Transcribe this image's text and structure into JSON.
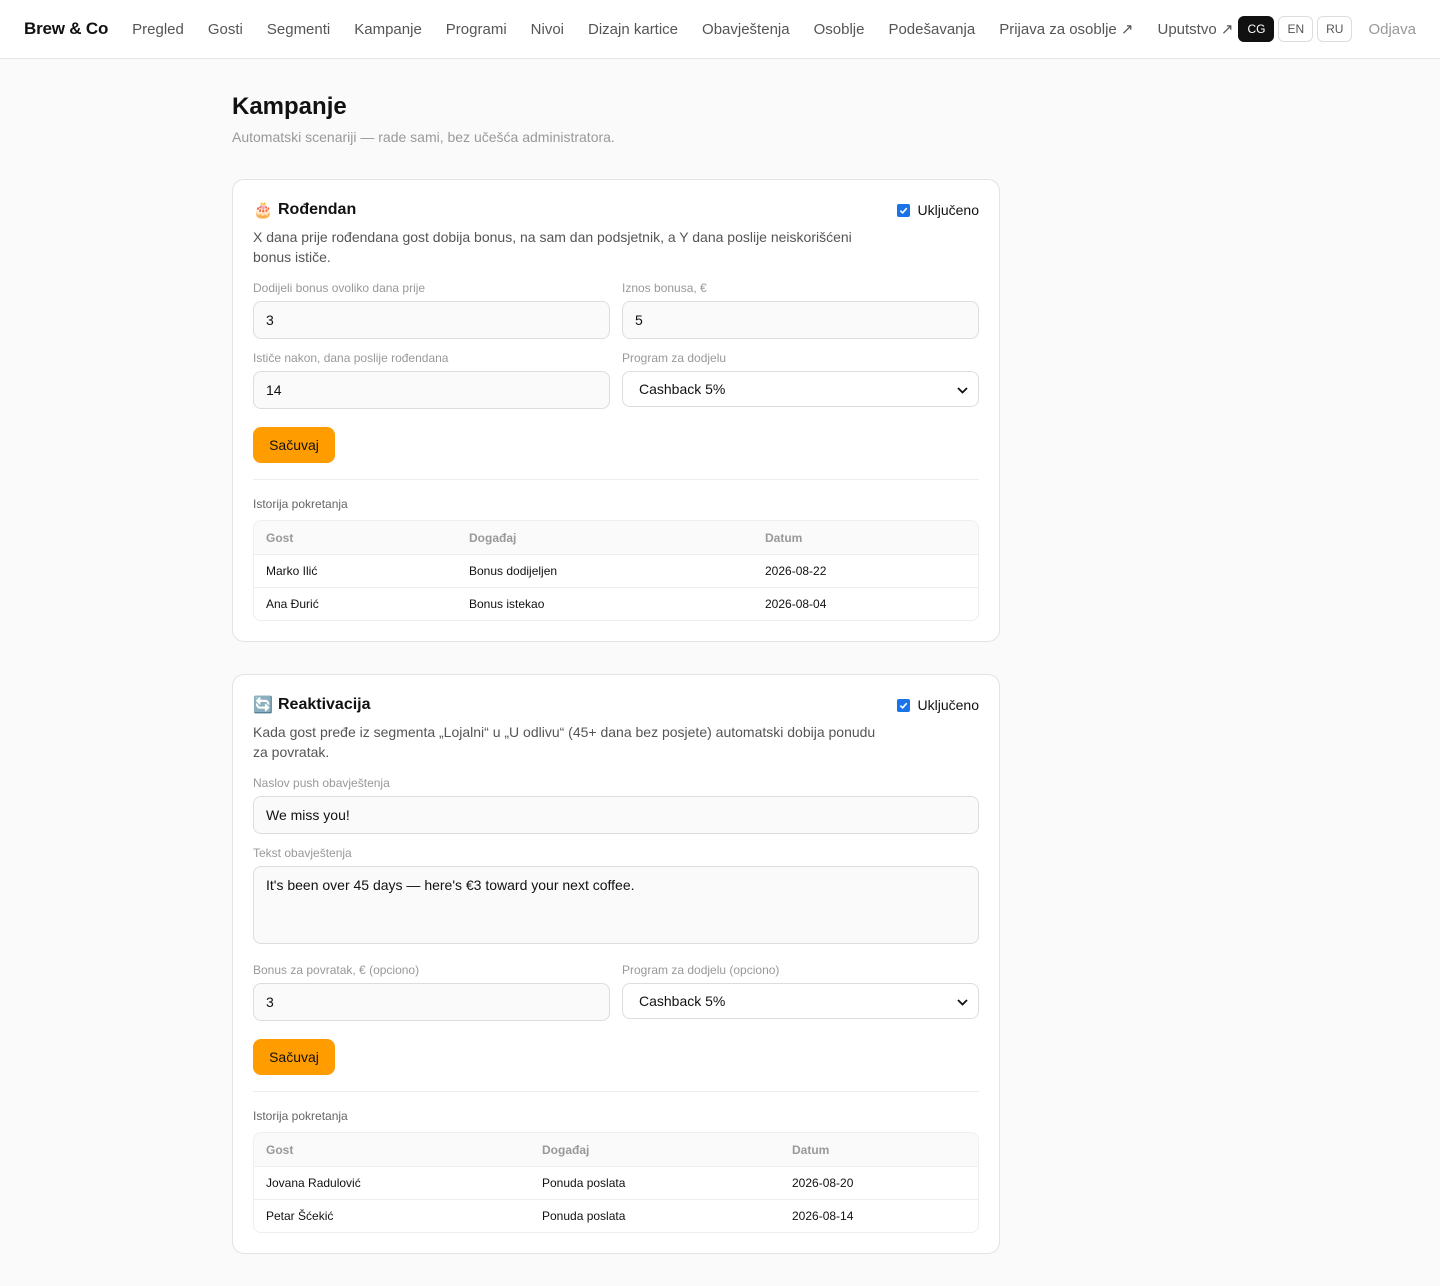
{
  "header": {
    "brand": "Brew & Co",
    "nav": [
      "Pregled",
      "Gosti",
      "Segmenti",
      "Kampanje",
      "Programi",
      "Nivoi",
      "Dizajn kartice",
      "Obavještenja",
      "Osoblje",
      "Podešavanja",
      "Prijava za osoblje ↗",
      "Uputstvo ↗"
    ],
    "languages": [
      "CG",
      "EN",
      "RU"
    ],
    "active_language": "CG",
    "logout": "Odjava"
  },
  "page": {
    "title": "Kampanje",
    "subtitle": "Automatski scenariji — rade sami, bez učešća administratora."
  },
  "colors": {
    "accent": "#ff9d00",
    "checkbox": "#1a73e8",
    "active_lang_bg": "#111111"
  },
  "birthday": {
    "icon": "birthday-cake-icon",
    "icon_glyph": "🎂",
    "title": "Rođendan",
    "enabled_label": "Uključeno",
    "enabled": true,
    "description": "X dana prije rođendana gost dobija bonus, na sam dan podsjetnik, a Y dana poslije neiskorišćeni bonus ističe.",
    "days_before_label": "Dodijeli bonus ovoliko dana prije",
    "days_before": "3",
    "amount_label": "Iznos bonusa, €",
    "amount": "5",
    "expires_label": "Ističe nakon, dana poslije rođendana",
    "expires": "14",
    "program_label": "Program za dodjelu",
    "program": "Cashback 5%",
    "save": "Sačuvaj",
    "history_label": "Istorija pokretanja",
    "columns": [
      "Gost",
      "Događaj",
      "Datum"
    ],
    "rows": [
      [
        "Marko Ilić",
        "Bonus dodijeljen",
        "2026-08-22"
      ],
      [
        "Ana Đurić",
        "Bonus istekao",
        "2026-08-04"
      ]
    ]
  },
  "reactivation": {
    "icon": "refresh-icon",
    "icon_glyph": "🔄",
    "title": "Reaktivacija",
    "enabled_label": "Uključeno",
    "enabled": true,
    "description": "Kada gost pređe iz segmenta „Lojalni“ u „U odlivu“ (45+ dana bez posjete) automatski dobija ponudu za povratak.",
    "push_title_label": "Naslov push obavještenja",
    "push_title": "We miss you!",
    "text_label": "Tekst obavještenja",
    "text": "It's been over 45 days — here's €3 toward your next coffee.",
    "bonus_label": "Bonus za povratak, € (opciono)",
    "bonus": "3",
    "program_label": "Program za dodjelu (opciono)",
    "program": "Cashback 5%",
    "save": "Sačuvaj",
    "history_label": "Istorija pokretanja",
    "columns": [
      "Gost",
      "Događaj",
      "Datum"
    ],
    "rows": [
      [
        "Jovana Radulović",
        "Ponuda poslata",
        "2026-08-20"
      ],
      [
        "Petar Šćekić",
        "Ponuda poslata",
        "2026-08-14"
      ]
    ]
  }
}
